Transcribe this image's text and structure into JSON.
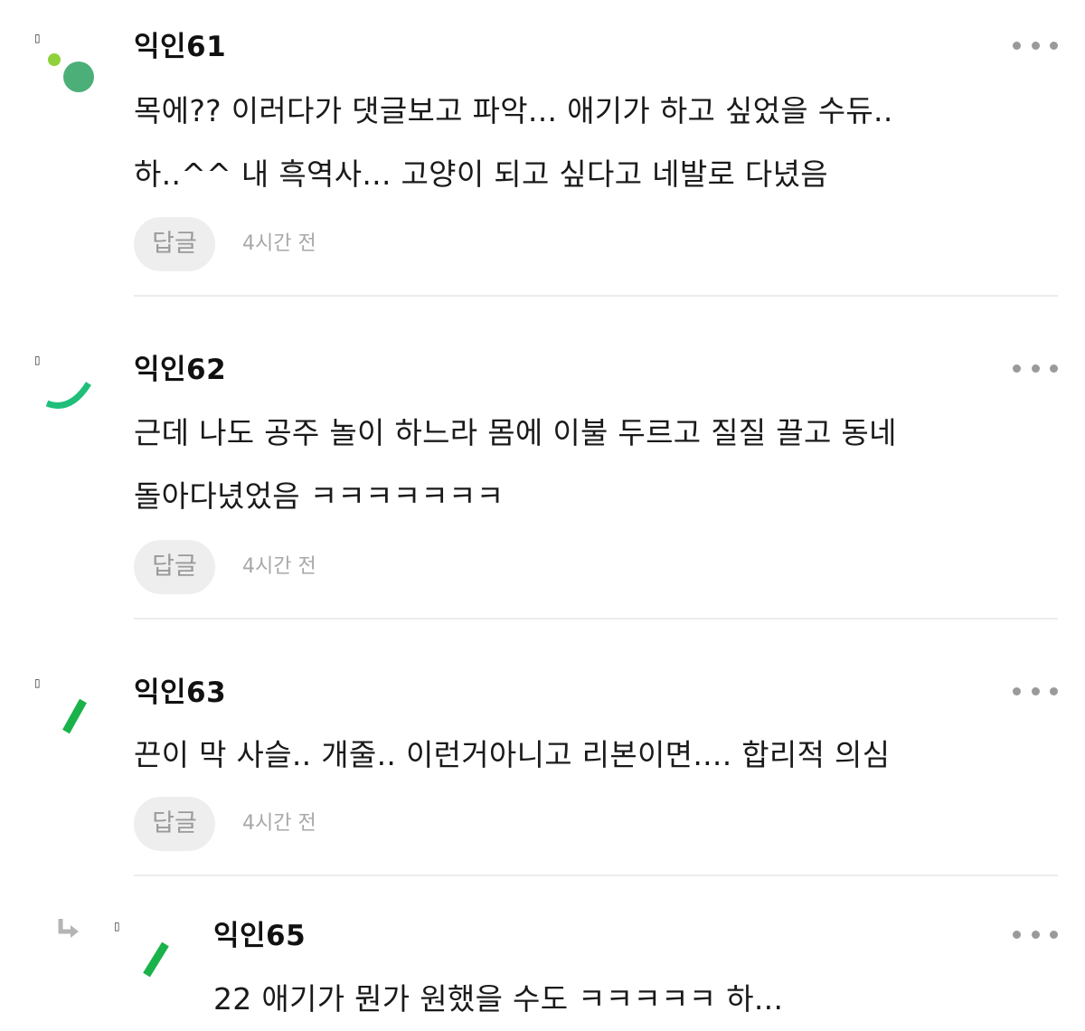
{
  "comments": [
    {
      "nickname": "익인61",
      "lines": [
        "목에?? 이러다가 댓글보고 파악... 애기가 하고 싶었을 수듀..",
        "하..^^ 내 흑역사... 고양이 되고 싶다고 네발로 다녔음"
      ],
      "reply_label": "답글",
      "time": "4시간 전",
      "avatar_marker": "▯"
    },
    {
      "nickname": "익인62",
      "lines": [
        "근데 나도 공주 놀이 하느라 몸에 이불 두르고 질질 끌고 동네",
        "돌아다녔었음 ㅋㅋㅋㅋㅋㅋㅋ"
      ],
      "reply_label": "답글",
      "time": "4시간 전",
      "avatar_marker": "▯"
    },
    {
      "nickname": "익인63",
      "lines": [
        "끈이 막 사슬.. 개줄.. 이런거아니고 리본이면.... 합리적 의심"
      ],
      "reply_label": "답글",
      "time": "4시간 전",
      "avatar_marker": "▯"
    },
    {
      "nickname": "익인65",
      "lines": [
        "22 애기가 뭔가 원했을 수도 ㅋㅋㅋㅋㅋ 하..."
      ],
      "avatar_marker": "▯"
    }
  ],
  "colors": {
    "avatar_green_light": "#8fd13a",
    "avatar_green": "#4caf78",
    "avatar_teal": "#1fbf7a",
    "avatar_bright_green": "#1ab24a",
    "reply_bg": "#eeeeee",
    "muted_text": "#a8a8a8",
    "divider": "#ececec"
  },
  "icons": {
    "more": "more-horizontal-icon",
    "reply_indent": "reply-arrow-icon"
  }
}
